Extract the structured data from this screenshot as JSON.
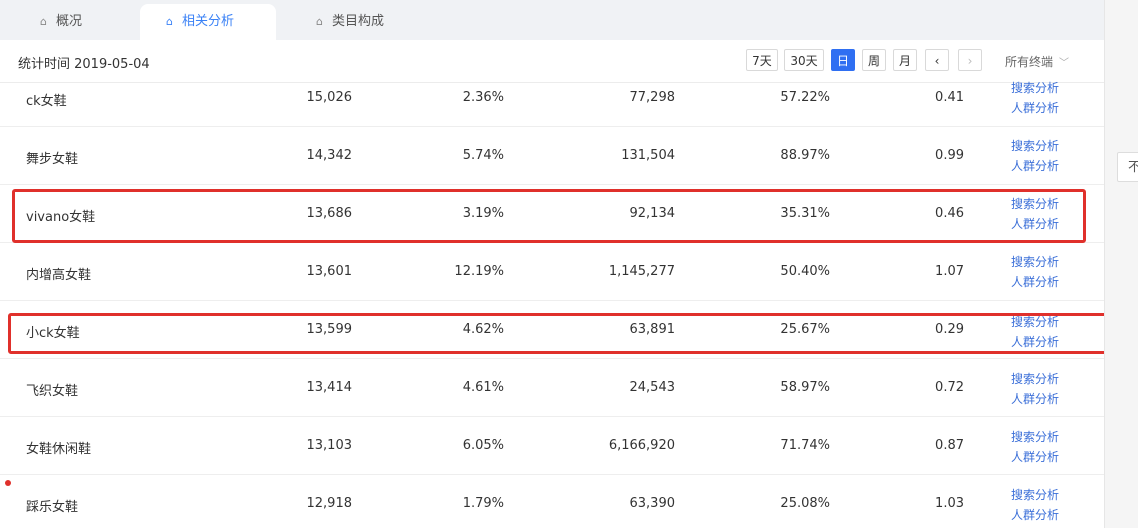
{
  "tabs": [
    {
      "label": "概况",
      "icon": "home-icon"
    },
    {
      "label": "相关分析",
      "icon": "home-icon",
      "active": true
    },
    {
      "label": "类目构成",
      "icon": "home-icon"
    }
  ],
  "toolbar": {
    "stat_time": "统计时间 2019-05-04",
    "periods": [
      "7天",
      "30天",
      "日",
      "周",
      "月"
    ],
    "active_period": "日",
    "prev_icon": "‹",
    "next_icon": "›",
    "dropdown": "所有终端"
  },
  "rows": [
    {
      "name": "ck女鞋",
      "v1": "15,026",
      "v2": "2.36%",
      "v3": "77,298",
      "v4": "57.22%",
      "v5": "0.41"
    },
    {
      "name": "舞步女鞋",
      "v1": "14,342",
      "v2": "5.74%",
      "v3": "131,504",
      "v4": "88.97%",
      "v5": "0.99"
    },
    {
      "name": "vivano女鞋",
      "v1": "13,686",
      "v2": "3.19%",
      "v3": "92,134",
      "v4": "35.31%",
      "v5": "0.46"
    },
    {
      "name": "内增高女鞋",
      "v1": "13,601",
      "v2": "12.19%",
      "v3": "1,145,277",
      "v4": "50.40%",
      "v5": "1.07"
    },
    {
      "name": "小ck女鞋",
      "v1": "13,599",
      "v2": "4.62%",
      "v3": "63,891",
      "v4": "25.67%",
      "v5": "0.29"
    },
    {
      "name": "飞织女鞋",
      "v1": "13,414",
      "v2": "4.61%",
      "v3": "24,543",
      "v4": "58.97%",
      "v5": "0.72"
    },
    {
      "name": "女鞋休闲鞋",
      "v1": "13,103",
      "v2": "6.05%",
      "v3": "6,166,920",
      "v4": "71.74%",
      "v5": "0.87"
    },
    {
      "name": "踩乐女鞋",
      "v1": "12,918",
      "v2": "1.79%",
      "v3": "63,390",
      "v4": "25.08%",
      "v5": "1.03"
    }
  ],
  "row_links": {
    "search": "搜索分析",
    "crowd": "人群分析"
  },
  "side_button": "不",
  "colors": {
    "accent": "#2f6ff2",
    "highlight": "#e0302b",
    "link": "#3b6fd8"
  }
}
